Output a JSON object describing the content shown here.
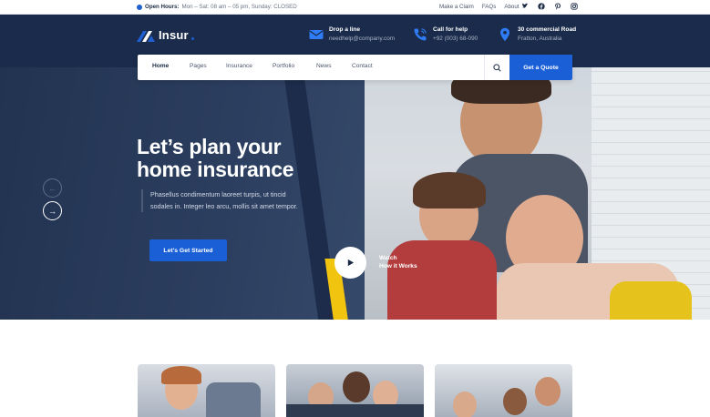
{
  "topbar": {
    "open_hours_label": "Open Hours:",
    "open_hours_value": "Mon – Sat: 08 am – 05 pm, Sunday: CLOSED",
    "links": [
      "Make a Claim",
      "FAQs",
      "About"
    ],
    "social_icons": [
      "twitter-icon",
      "facebook-icon",
      "pinterest-icon",
      "instagram-icon"
    ]
  },
  "header": {
    "logo_text": "Insur",
    "contacts": [
      {
        "icon": "envelope-icon",
        "title": "Drop a line",
        "value": "needhelp@company.com"
      },
      {
        "icon": "phone-icon",
        "title": "Call for help",
        "value": "+92 (003) 68-090"
      },
      {
        "icon": "location-pin-icon",
        "title": "30 commercial Road",
        "value": "Fratton, Australia"
      }
    ]
  },
  "nav": {
    "items": [
      "Home",
      "Pages",
      "Insurance",
      "Portfolio",
      "News",
      "Contact"
    ],
    "active": "Home",
    "quote_label": "Get a Quote"
  },
  "hero": {
    "title_line1": "Let’s plan your",
    "title_line2": "home insurance",
    "description": "Phasellus condimentum laoreet turpis, ut tincid sodales in. Integer leo arcu, mollis sit amet tempor.",
    "cta_label": "Let’s Get Started",
    "watch_line1": "Watch",
    "watch_line2": "How it Works"
  },
  "colors": {
    "brand_blue": "#1a5fd6",
    "header_navy": "#1a2b4b",
    "accent_yellow": "#f1c40f"
  }
}
